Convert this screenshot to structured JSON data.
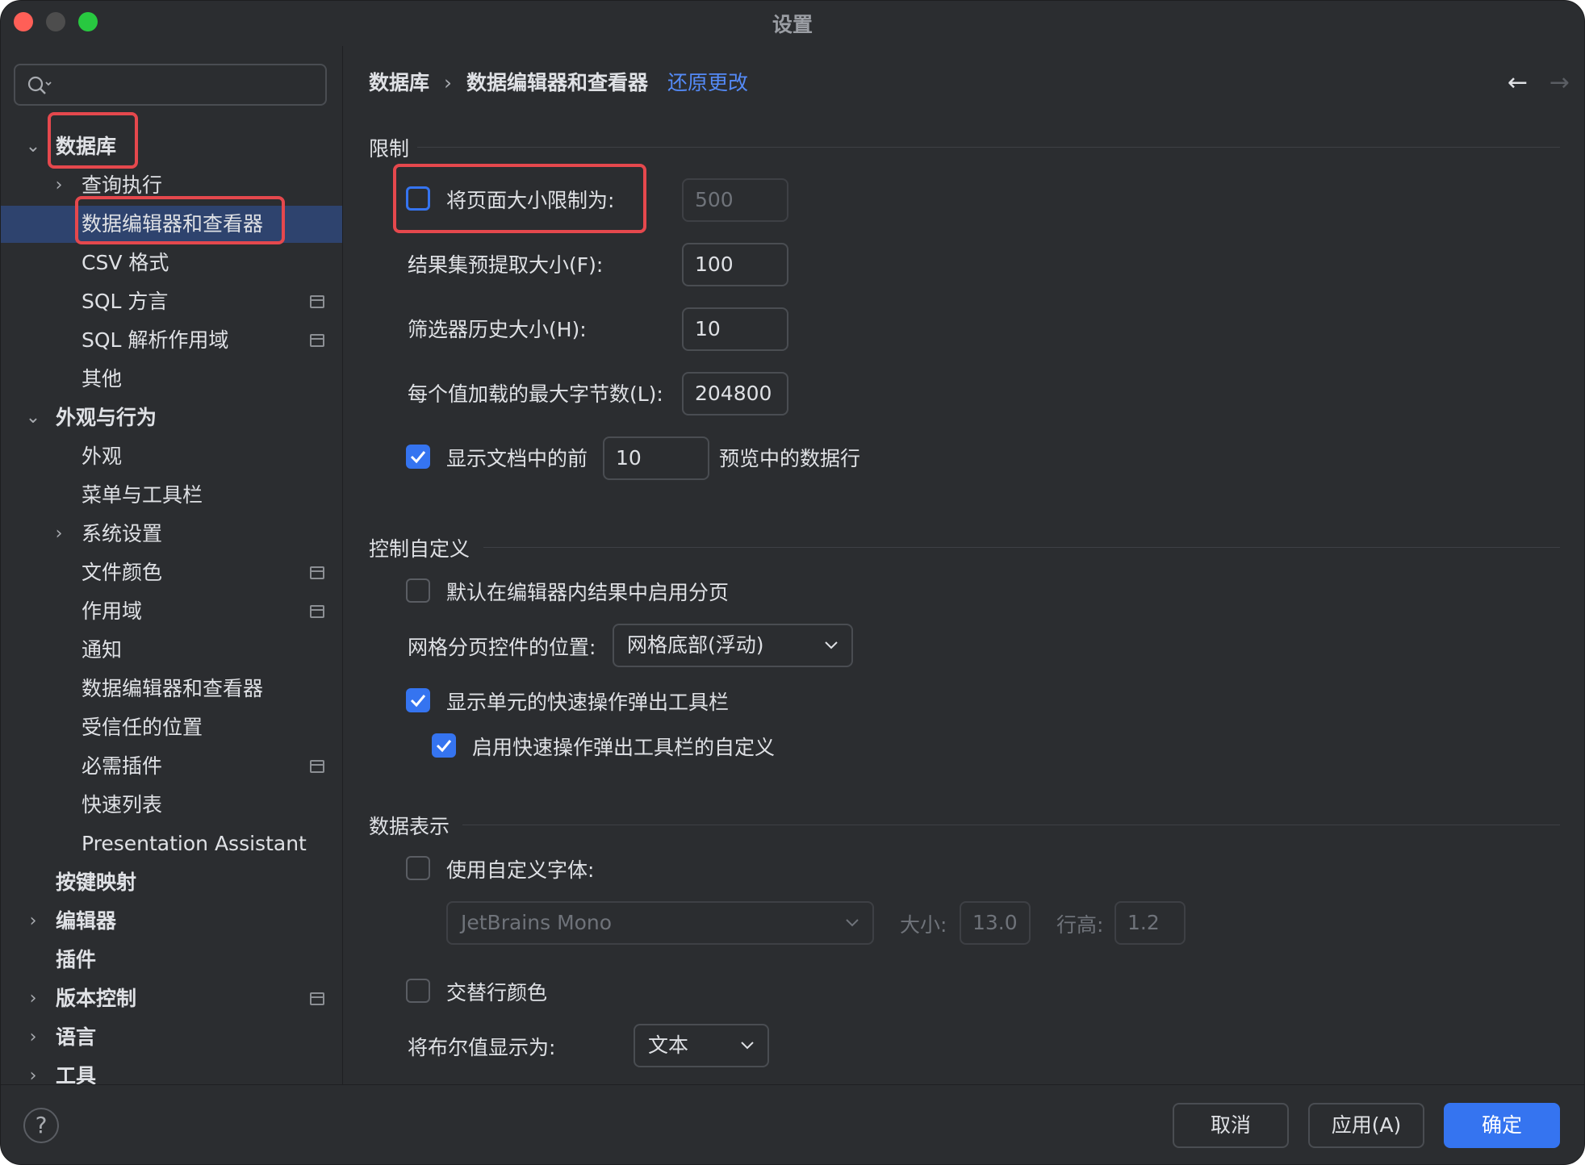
{
  "window": {
    "title": "设置"
  },
  "colors": {
    "close": "#ff5f57",
    "minimize": "#4d4d4d",
    "maximize": "#28c840",
    "accent": "#3574f0",
    "highlight": "#e5484d"
  },
  "sidebar": {
    "search_placeholder": "",
    "items": [
      {
        "label": "数据库"
      },
      {
        "label": "查询执行"
      },
      {
        "label": "数据编辑器和查看器"
      },
      {
        "label": "CSV 格式"
      },
      {
        "label": "SQL 方言"
      },
      {
        "label": "SQL 解析作用域"
      },
      {
        "label": "其他"
      },
      {
        "label": "外观与行为"
      },
      {
        "label": "外观"
      },
      {
        "label": "菜单与工具栏"
      },
      {
        "label": "系统设置"
      },
      {
        "label": "文件颜色"
      },
      {
        "label": "作用域"
      },
      {
        "label": "通知"
      },
      {
        "label": "数据编辑器和查看器"
      },
      {
        "label": "受信任的位置"
      },
      {
        "label": "必需插件"
      },
      {
        "label": "快速列表"
      },
      {
        "label": "Presentation Assistant"
      },
      {
        "label": "按键映射"
      },
      {
        "label": "编辑器"
      },
      {
        "label": "插件"
      },
      {
        "label": "版本控制"
      },
      {
        "label": "语言"
      },
      {
        "label": "工具"
      }
    ]
  },
  "header": {
    "breadcrumb_parent": "数据库",
    "breadcrumb_separator": "›",
    "breadcrumb_current": "数据编辑器和查看器",
    "reset_link": "还原更改",
    "back_arrow": "←",
    "forward_arrow": "→"
  },
  "limits": {
    "title": "限制",
    "page_size_label": "将页面大小限制为:",
    "page_size_value": "500",
    "prefetch_label": "结果集预提取大小(F):",
    "prefetch_value": "100",
    "filter_history_label": "筛选器历史大小(H):",
    "filter_history_value": "10",
    "max_bytes_label": "每个值加载的最大字节数(L):",
    "max_bytes_value": "204800",
    "show_rows_label_before": "显示文档中的前",
    "show_rows_value": "10",
    "show_rows_label_after": "预览中的数据行"
  },
  "controls": {
    "title": "控制自定义",
    "enable_paging_label": "默认在编辑器内结果中启用分页",
    "paging_position_label": "网格分页控件的位置:",
    "paging_position_value": "网格底部(浮动)",
    "quick_toolbar_label": "显示单元的快速操作弹出工具栏",
    "quick_toolbar_custom_label": "启用快速操作弹出工具栏的自定义"
  },
  "data_display": {
    "title": "数据表示",
    "custom_font_label": "使用自定义字体:",
    "font_value": "JetBrains Mono",
    "size_label": "大小:",
    "size_value": "13.0",
    "line_height_label": "行高:",
    "line_height_value": "1.2",
    "alt_row_color_label": "交替行颜色",
    "boolean_label": "将布尔值显示为:",
    "boolean_value": "文本"
  },
  "footer": {
    "help_label": "?",
    "cancel_label": "取消",
    "apply_label": "应用(A)",
    "ok_label": "确定"
  }
}
